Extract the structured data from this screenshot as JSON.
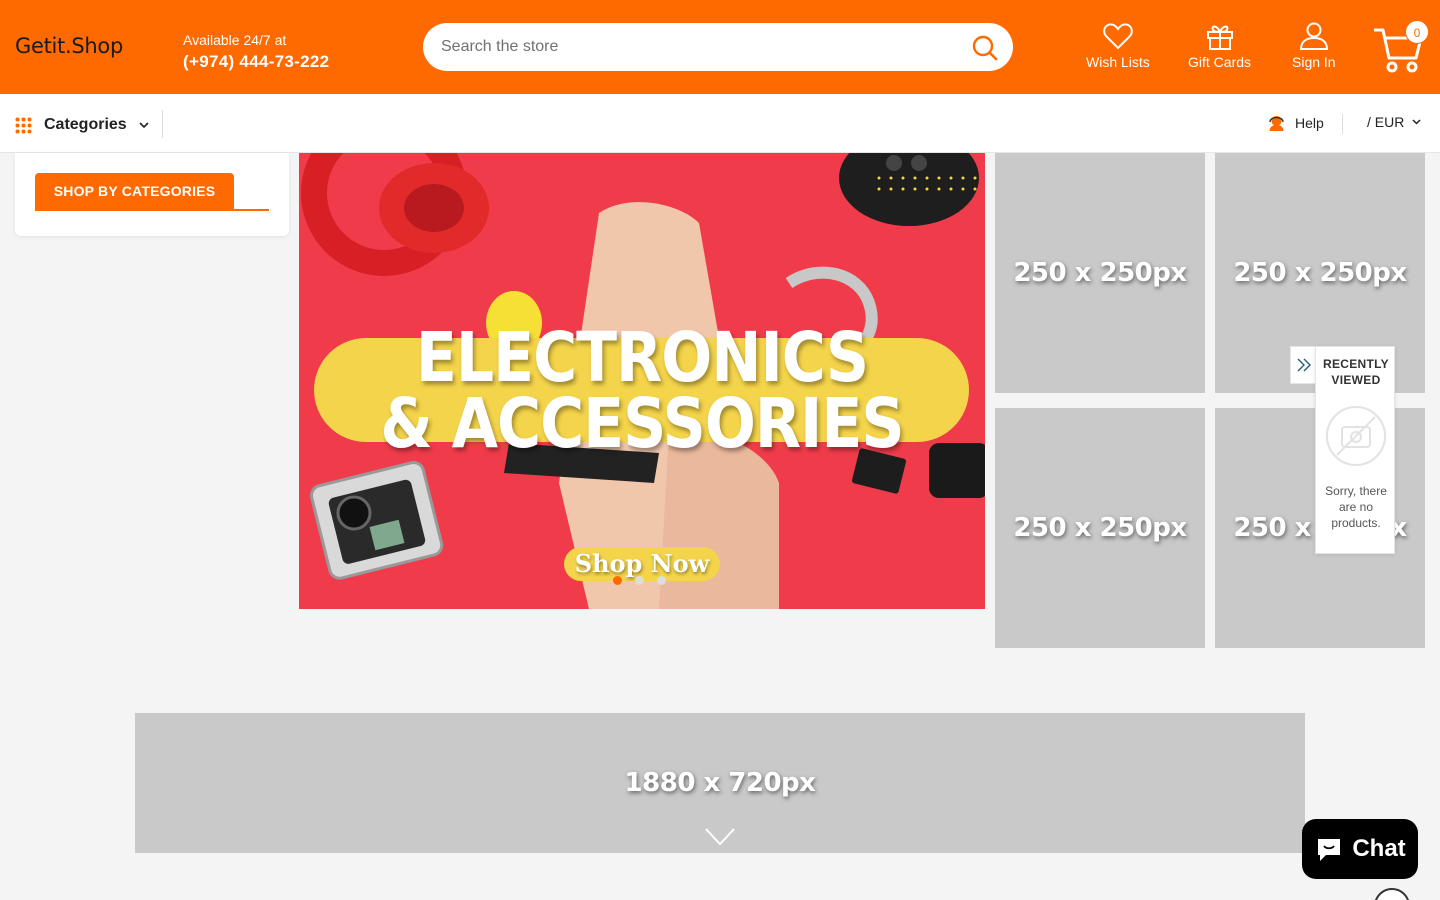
{
  "colors": {
    "brand": "#ff6a00",
    "page_bg": "#f4f4f4",
    "placeholder_bg": "#c9c9c9",
    "hero_bg": "#f03c4a",
    "hero_accent": "#f4d44a"
  },
  "header": {
    "logo": "Getit.Shop",
    "availability": "Available 24/7 at",
    "phone": "(+974) 444-73-222",
    "search": {
      "placeholder": "Search the store",
      "icon": "search-icon"
    },
    "links": [
      {
        "label": "Wish Lists",
        "icon": "heart-icon"
      },
      {
        "label": "Gift Cards",
        "icon": "gift-icon"
      },
      {
        "label": "Sign In",
        "icon": "user-icon"
      }
    ],
    "cart": {
      "count": "0",
      "icon": "cart-icon"
    }
  },
  "navbar": {
    "categories_label": "Categories",
    "help_label": "Help",
    "currency_label": "/ EUR"
  },
  "sidebar": {
    "title": "SHOP BY CATEGORIES"
  },
  "hero": {
    "line1": "ELECTRONICS",
    "line2": "& ACCESSORIES",
    "cta": "Shop Now",
    "slides": 3,
    "active_slide": 1
  },
  "banners": [
    {
      "label": "250 x 250px"
    },
    {
      "label": "250 x 250px"
    },
    {
      "label": "250 x 250px"
    },
    {
      "label": "250 x 250px"
    }
  ],
  "recently_viewed": {
    "title": "RECENTLY VIEWED",
    "empty_message": "Sorry, there are no products."
  },
  "wide_banner": {
    "label": "1880 x 720px"
  },
  "chat": {
    "label": "Chat"
  }
}
